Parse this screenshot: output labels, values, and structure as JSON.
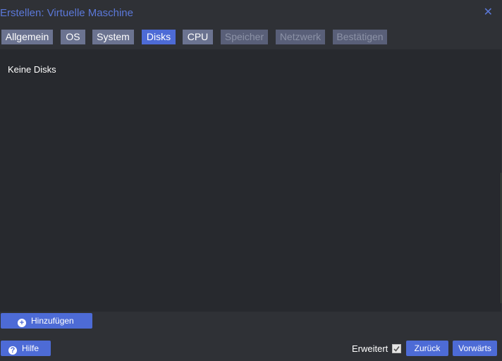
{
  "window": {
    "title": "Erstellen: Virtuelle Maschine",
    "close_icon": "close-icon"
  },
  "tabs": [
    {
      "label": "Allgemein",
      "state": "enabled"
    },
    {
      "label": "OS",
      "state": "enabled"
    },
    {
      "label": "System",
      "state": "enabled"
    },
    {
      "label": "Disks",
      "state": "active"
    },
    {
      "label": "CPU",
      "state": "enabled"
    },
    {
      "label": "Speicher",
      "state": "disabled"
    },
    {
      "label": "Netzwerk",
      "state": "disabled"
    },
    {
      "label": "Bestätigen",
      "state": "disabled"
    }
  ],
  "panel": {
    "empty_message": "Keine Disks"
  },
  "footer": {
    "add_label": "Hinzufügen",
    "add_icon": "plus-circle-icon",
    "help_label": "Hilfe",
    "help_icon": "question-circle-icon",
    "advanced_label": "Erweitert",
    "advanced_checked": true,
    "back_label": "Zurück",
    "next_label": "Vorwärts"
  },
  "colors": {
    "accent": "#4d6bd6",
    "title": "#5b78d8",
    "background": "#2f3136",
    "panel": "#27292e"
  }
}
